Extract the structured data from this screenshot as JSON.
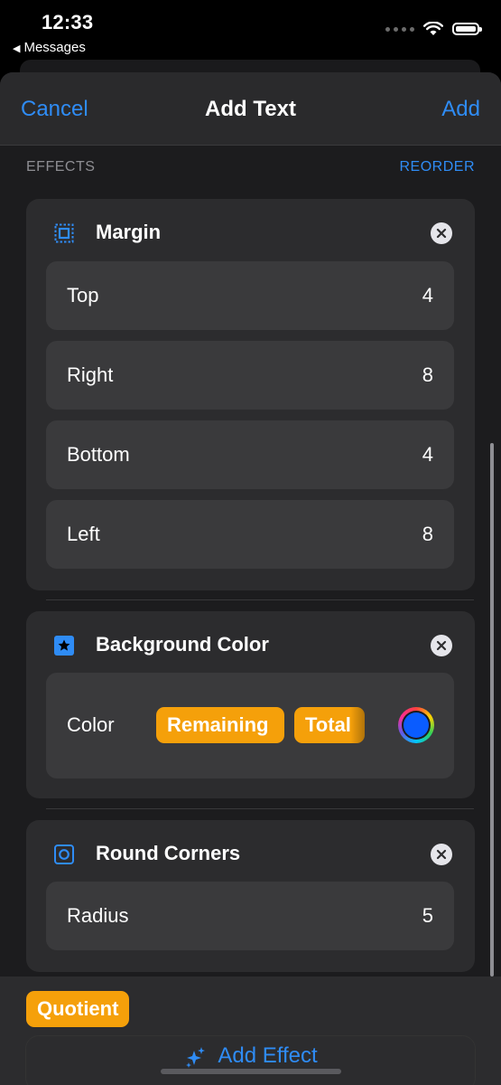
{
  "status_bar": {
    "time": "12:33",
    "back_app": "Messages"
  },
  "nav": {
    "cancel": "Cancel",
    "title": "Add Text",
    "add": "Add"
  },
  "section": {
    "header": "EFFECTS",
    "action": "REORDER"
  },
  "effects": {
    "margin": {
      "title": "Margin",
      "icon": "margin-icon",
      "rows": [
        {
          "label": "Top",
          "value": "4"
        },
        {
          "label": "Right",
          "value": "8"
        },
        {
          "label": "Bottom",
          "value": "4"
        },
        {
          "label": "Left",
          "value": "8"
        }
      ]
    },
    "background_color": {
      "title": "Background Color",
      "icon": "star-square-icon",
      "row_label": "Color",
      "chips": [
        "Remaining",
        "Total"
      ],
      "swatch_color": "#0a5cff"
    },
    "round_corners": {
      "title": "Round Corners",
      "icon": "rounded-square-icon",
      "row_label": "Radius",
      "row_value": "5"
    }
  },
  "bottom": {
    "floating_chip": "Quotient",
    "add_effect": "Add Effect"
  },
  "colors": {
    "accent": "#2f8cf5",
    "chip": "#f5a00a",
    "card": "#2c2c2e",
    "row": "#3a3a3c"
  }
}
